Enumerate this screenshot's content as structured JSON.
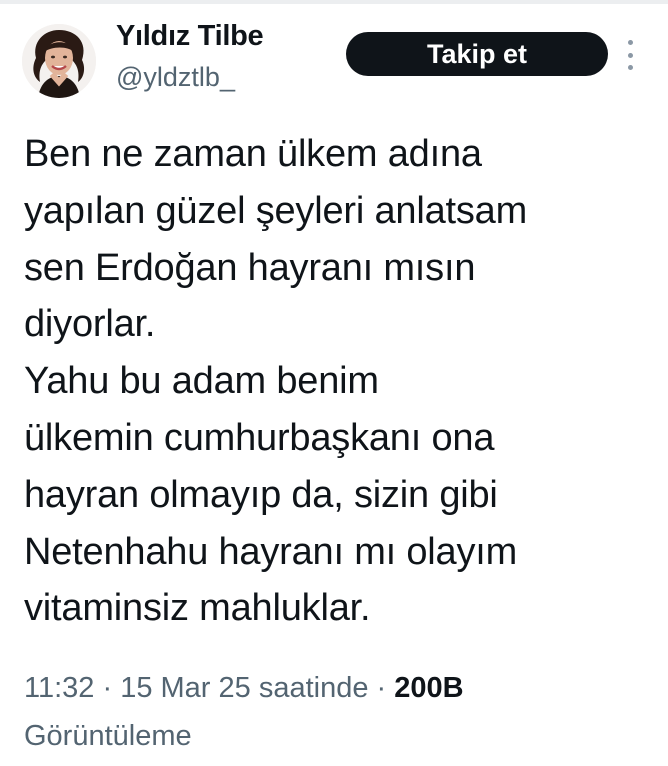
{
  "author": {
    "display_name": "Yıldız Tilbe",
    "handle": "@yldztlb_",
    "avatar_icon": "profile-photo-icon"
  },
  "actions": {
    "follow_label": "Takip et",
    "more_icon": "more-options-icon"
  },
  "tweet": {
    "lines": [
      "Ben ne zaman ülkem adına",
      "yapılan güzel şeyleri anlatsam",
      "sen Erdoğan hayranı mısın",
      "diyorlar.",
      "Yahu bu adam benim",
      "ülkemin cumhurbaşkanı ona",
      "hayran olmayıp da, sizin gibi",
      "Netenhahu hayranı mı olayım",
      "vitaminsiz mahluklar."
    ]
  },
  "meta": {
    "time": "11:32",
    "separator": " · ",
    "date": "15 Mar 25 saatinde",
    "views_count": "200B",
    "views_label": "Görüntüleme"
  },
  "colors": {
    "text": "#0f1419",
    "secondary": "#536471",
    "button_bg": "#0f1419",
    "button_text": "#ffffff"
  }
}
